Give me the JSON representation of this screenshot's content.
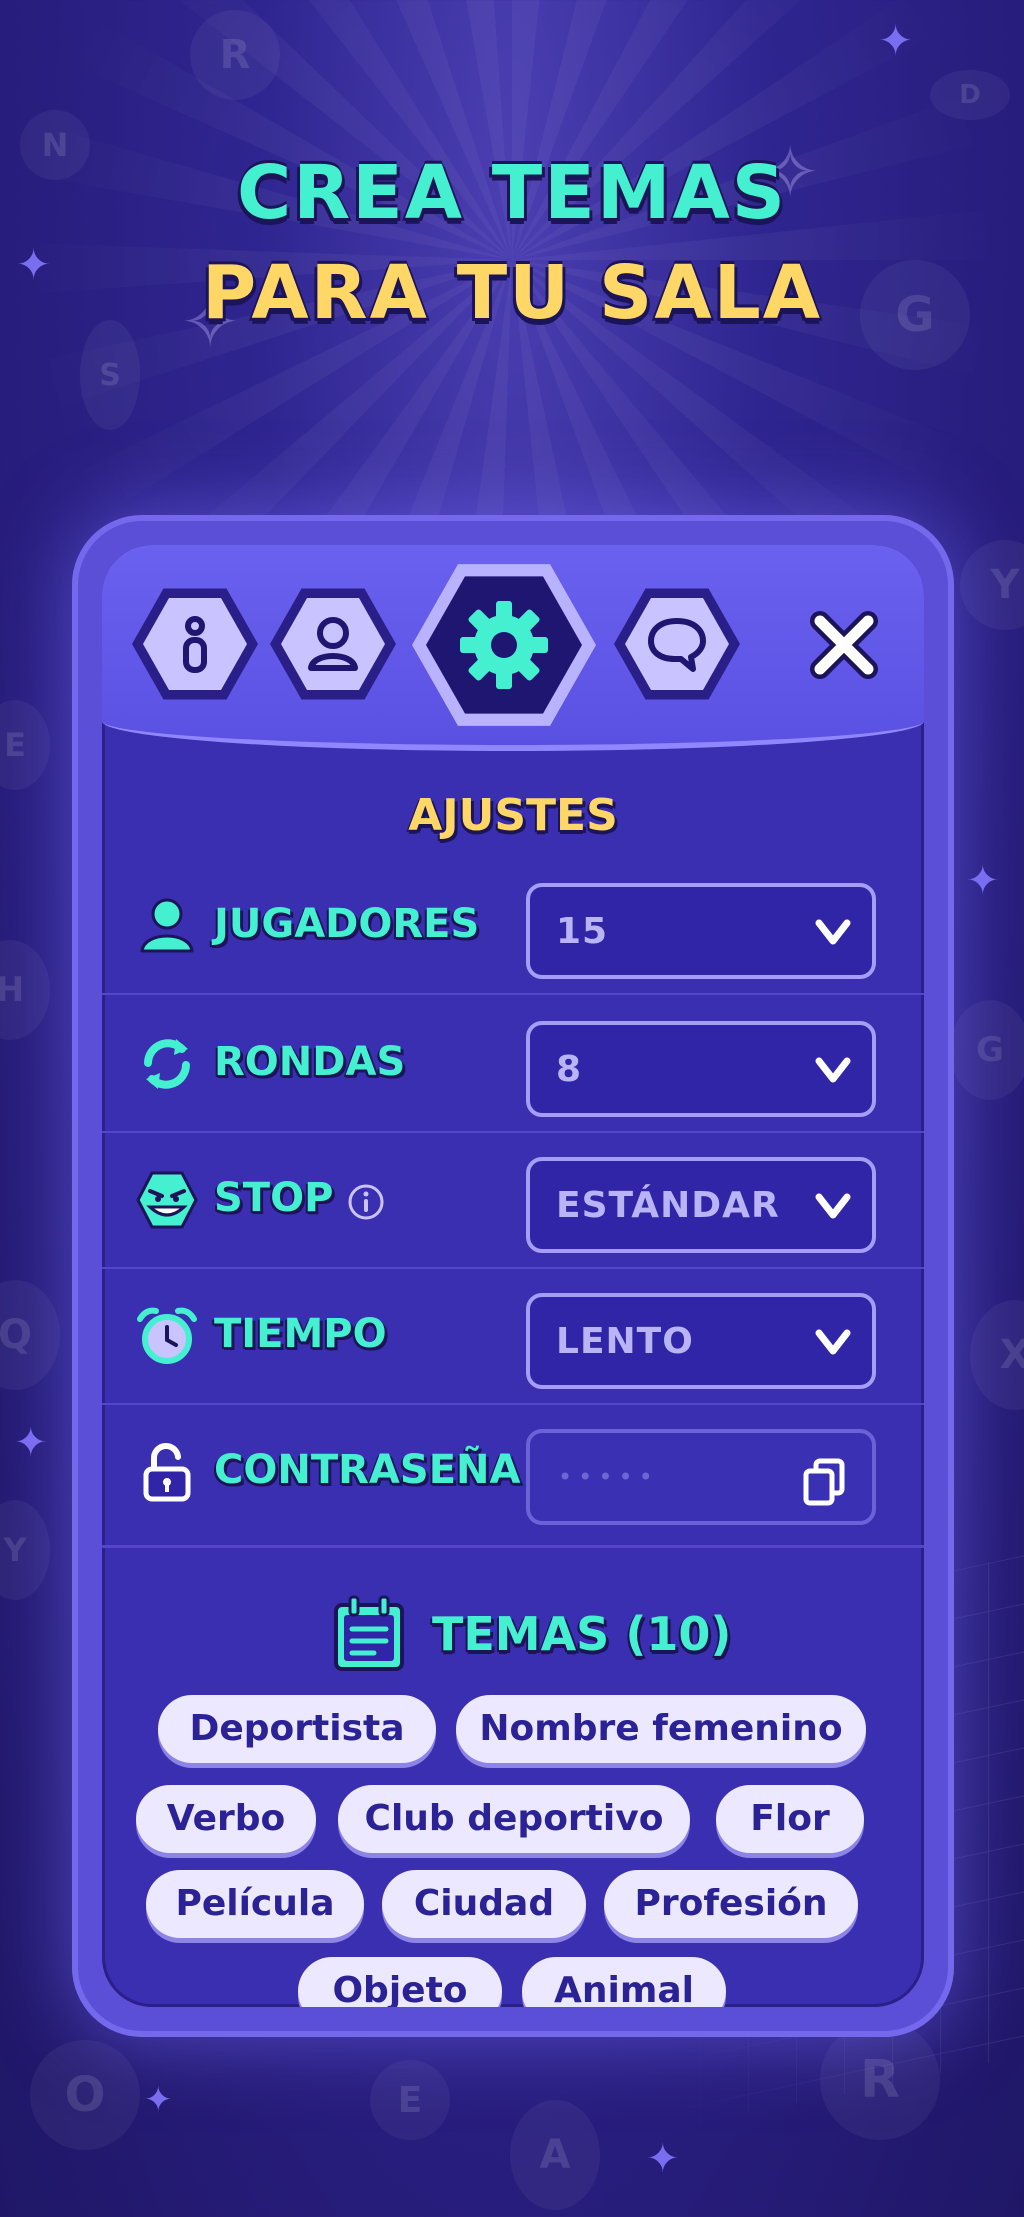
{
  "headline": {
    "line1": "CREA TEMAS",
    "line2": "PARA TU SALA"
  },
  "colors": {
    "accent_teal": "#45f0d0",
    "accent_yellow": "#ffd766",
    "panel": "#3a2fb0"
  },
  "tabs": [
    {
      "icon": "info-icon",
      "active": false
    },
    {
      "icon": "user-icon",
      "active": false
    },
    {
      "icon": "gear-icon",
      "active": true
    },
    {
      "icon": "chat-icon",
      "active": false
    }
  ],
  "close_icon": "close-icon",
  "settings": {
    "title": "AJUSTES",
    "rows": [
      {
        "icon": "user-icon",
        "label": "JUGADORES",
        "value": "15"
      },
      {
        "icon": "refresh-icon",
        "label": "RONDAS",
        "value": "8"
      },
      {
        "icon": "monster-face-icon",
        "label": "STOP",
        "value": "ESTÁNDAR",
        "info_icon": "info-circle-icon"
      },
      {
        "icon": "alarm-clock-icon",
        "label": "TIEMPO",
        "value": "LENTO"
      },
      {
        "icon": "unlocked-padlock-icon",
        "label": "CONTRASEÑA",
        "value": "•••••",
        "copy_icon": "copy-icon"
      }
    ]
  },
  "temas": {
    "label": "TEMAS (10)",
    "icon": "notepad-icon",
    "items": [
      "Deportista",
      "Nombre femenino",
      "Verbo",
      "Club deportivo",
      "Flor",
      "Película",
      "Ciudad",
      "Profesión",
      "Objeto",
      "Animal"
    ]
  }
}
